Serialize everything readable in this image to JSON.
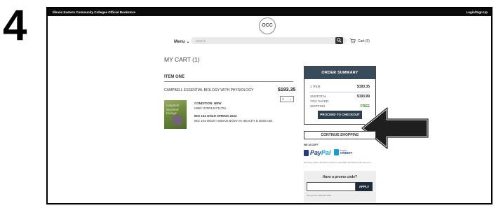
{
  "step_number": "4",
  "header": {
    "site_title": "Illinois Eastern Community Colleges Official Bookstore",
    "login_label": "Login/Sign Up"
  },
  "logo": {
    "text": "OCC"
  },
  "nav": {
    "menu_label": "Menu",
    "search_placeholder": "Search",
    "cart_label": "Cart (0)"
  },
  "cart": {
    "heading": "MY CART (1)",
    "item_heading": "ITEM ONE",
    "item": {
      "title": "CAMPBELL ESSENTIAL BIOLOGY WITH PHYSIOLOGY",
      "price": "$193.35",
      "quantity": "1",
      "cover_text": "campbell essential biology",
      "condition": "CONDITION: NEW",
      "isbn": "ISBN: 9780134711751",
      "course_code": "BIO 104 ONLN SPRING 2022",
      "course_name": "BIO 104 ONLN HUMAN BODY IN HEALTH & DISEASE"
    }
  },
  "summary": {
    "heading": "ORDER SUMMARY",
    "items_label": "1 ITEM",
    "items_value": "$193.35",
    "subtotal_label": "SUBTOTAL",
    "subtotal_value": "$193.99",
    "saved_label": "YOU SAVED:",
    "shipping_label": "SHIPPING",
    "shipping_value": "FREE",
    "checkout_label": "PROCEED TO CHECKOUT"
  },
  "continue_label": "CONTINUE SHOPPING",
  "payment": {
    "accept_label": "WE ACCEPT",
    "paypal_part1": "Pay",
    "paypal_part2": "Pal",
    "credit_small": "PayPal",
    "credit_label": "CREDIT",
    "fine_print": "No Interest if paid in full within 6 months on orders $99+ with PayPal Credit. See terms."
  },
  "promo": {
    "label": "Have a promo code?",
    "apply_label": "APPLY",
    "note": "One promo code per order"
  },
  "colors": {
    "summary_header": "#394a5a",
    "checkout_button": "#2f3e4d",
    "free_shipping": "#3c8d2f",
    "paypal_dark": "#253b80",
    "paypal_light": "#179bd7"
  }
}
